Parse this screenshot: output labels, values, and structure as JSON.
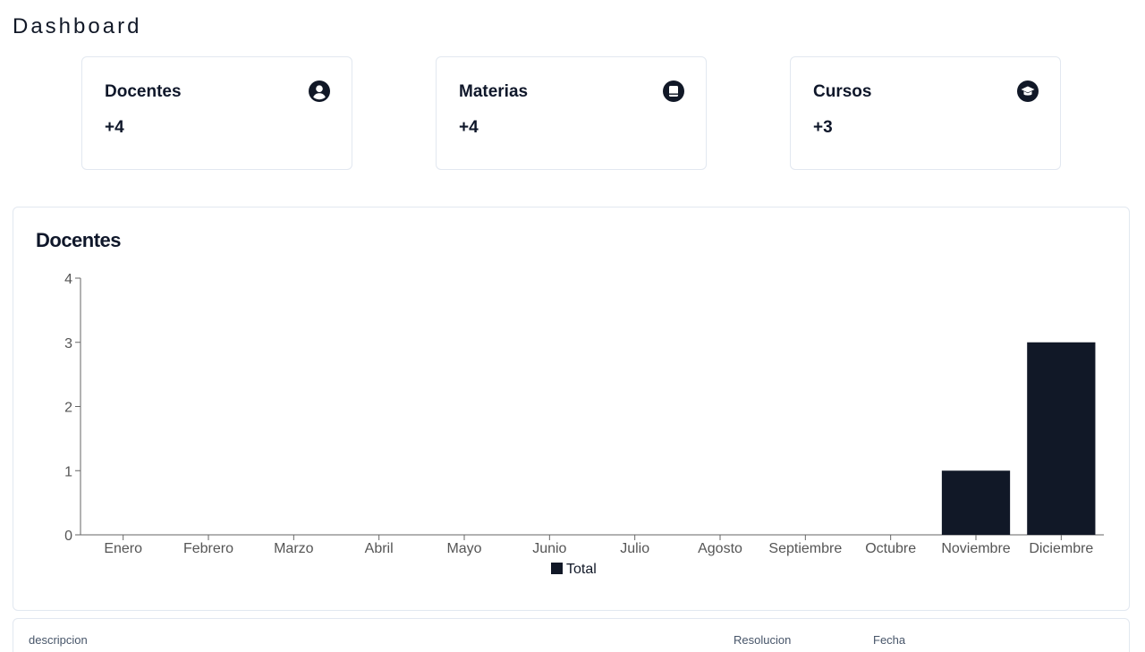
{
  "page": {
    "title": "Dashboard"
  },
  "stats": [
    {
      "label": "Docentes",
      "value": "+4",
      "icon": "user-circle-icon"
    },
    {
      "label": "Materias",
      "value": "+4",
      "icon": "book-icon"
    },
    {
      "label": "Cursos",
      "value": "+3",
      "icon": "graduation-cap-icon"
    }
  ],
  "chart_card": {
    "title": "Docentes"
  },
  "chart_data": {
    "type": "bar",
    "categories": [
      "Enero",
      "Febrero",
      "Marzo",
      "Abril",
      "Mayo",
      "Junio",
      "Julio",
      "Agosto",
      "Septiembre",
      "Octubre",
      "Noviembre",
      "Diciembre"
    ],
    "series": [
      {
        "name": "Total",
        "values": [
          0,
          0,
          0,
          0,
          0,
          0,
          0,
          0,
          0,
          0,
          1,
          3
        ],
        "color": "#111827"
      }
    ],
    "ylim": [
      0,
      4
    ],
    "yticks": [
      "0",
      "1",
      "2",
      "3",
      "4"
    ],
    "grid": false,
    "legend": "bottom-center"
  },
  "table": {
    "headers": [
      "descripcion",
      "Resolucion",
      "Fecha"
    ]
  }
}
